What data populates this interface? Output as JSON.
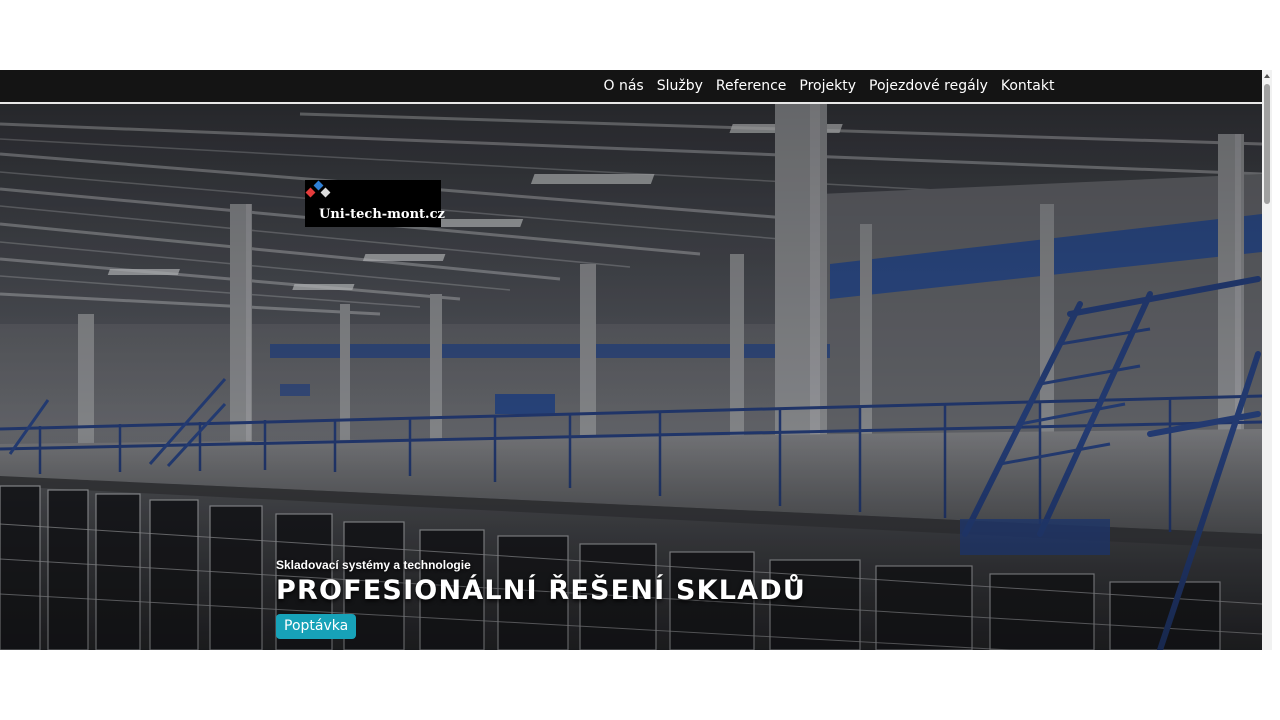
{
  "nav": {
    "items": [
      {
        "label": "O nás"
      },
      {
        "label": "Služby"
      },
      {
        "label": "Reference"
      },
      {
        "label": "Projekty"
      },
      {
        "label": "Pojezdové regály"
      },
      {
        "label": "Kontakt"
      }
    ]
  },
  "logo": {
    "text": "Uni-tech-mont.cz",
    "icon": "diamond-tiles-icon",
    "colors": [
      "#e43b3b",
      "#2f7fd6",
      "#dddddd"
    ]
  },
  "hero": {
    "subtitle": "Skladovací systémy a technologie",
    "title": "PROFESIONÁLNÍ ŘEŠENÍ SKLADŮ",
    "cta_label": "Poptávka",
    "cta_color": "#17a2b8"
  },
  "colors": {
    "navbar_bg": "#141414",
    "railing_blue": "#27407e"
  }
}
